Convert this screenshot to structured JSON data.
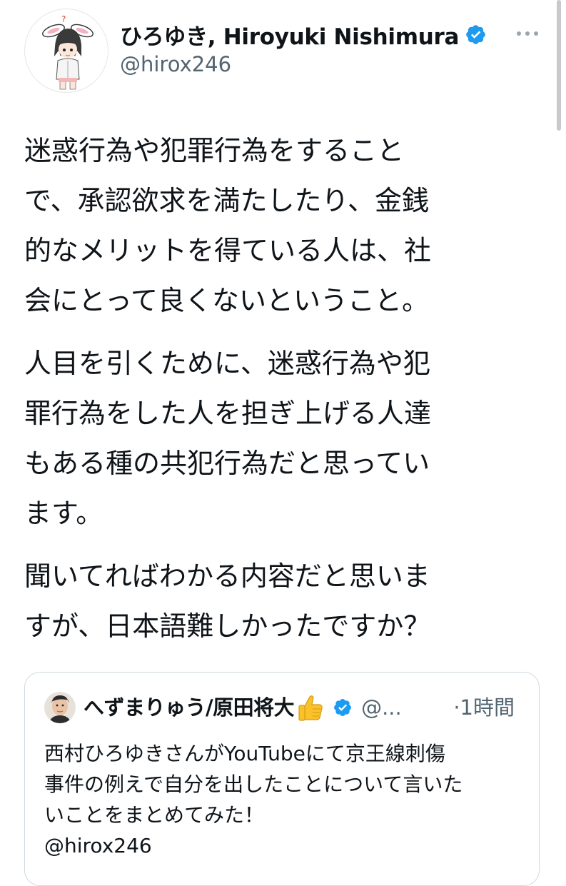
{
  "author": {
    "display_name": "ひろゆき, Hiroyuki Nishimura",
    "handle": "@hirox246",
    "verified": true
  },
  "tweet": {
    "paragraphs": [
      "迷惑行為や犯罪行為をすること\nで、承認欲求を満たしたり、金銭\n的なメリットを得ている人は、社\n会にとって良くないということ。",
      "人目を引くために、迷惑行為や犯\n罪行為をした人を担ぎ上げる人達\nもある種の共犯行為だと思ってい\nます。",
      "聞いてればわかる内容だと思いま\nすが、日本語難しかったですか？"
    ]
  },
  "quoted_tweet": {
    "display_name": "へずまりゅう/原田将大",
    "emoji": "thumbs-up",
    "verified": true,
    "handle_truncated": "@...",
    "time": "·1時間",
    "text": "西村ひろゆきさんがYouTubeにて京王線刺傷\n事件の例えで自分を出したことについて言いた\nいことをまとめてみた！\n@hirox246"
  },
  "colors": {
    "text": "#0f1419",
    "secondary": "#536471",
    "verified_blue": "#1d9bf0",
    "border": "#cfd9de"
  }
}
